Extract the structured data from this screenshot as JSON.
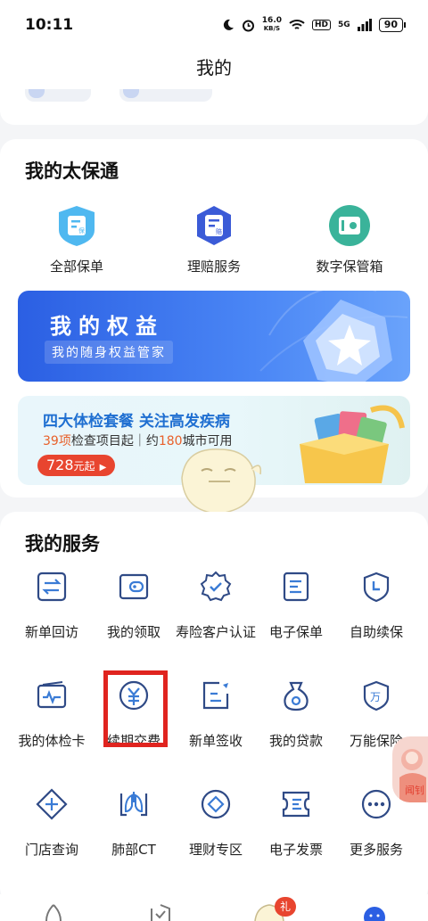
{
  "status_bar": {
    "time": "10:11",
    "net_speed_value": "16.0",
    "net_speed_unit": "KB/S",
    "hd": "HD",
    "network": "5G",
    "battery": "90"
  },
  "header": {
    "title": "我的"
  },
  "my_taibaotong": {
    "title": "我的太保通",
    "items": [
      {
        "label": "全部保单",
        "icon": "policy-shield-icon"
      },
      {
        "label": "理赔服务",
        "icon": "claim-service-icon"
      },
      {
        "label": "数字保管箱",
        "icon": "digital-safe-icon"
      }
    ]
  },
  "rights_banner": {
    "title": "我的权益",
    "subtitle": "我的随身权益管家"
  },
  "checkup_banner": {
    "title": "四大体检套餐  关注高发疾病",
    "sub_num1": "39项",
    "sub_text1": "检查项目起｜约",
    "sub_num2": "180",
    "sub_text2": "城市可用",
    "price": "728",
    "price_unit": "元起"
  },
  "my_services": {
    "title": "我的服务",
    "items": [
      {
        "label": "新单回访",
        "icon": "exchange-icon"
      },
      {
        "label": "我的领取",
        "icon": "wallet-icon"
      },
      {
        "label": "寿险客户认证",
        "icon": "verified-badge-icon"
      },
      {
        "label": "电子保单",
        "icon": "document-icon"
      },
      {
        "label": "自助续保",
        "icon": "shield-clock-icon"
      },
      {
        "label": "我的体检卡",
        "icon": "health-card-icon"
      },
      {
        "label": "续期交费",
        "icon": "yuan-payment-icon"
      },
      {
        "label": "新单签收",
        "icon": "sign-icon"
      },
      {
        "label": "我的贷款",
        "icon": "money-bag-icon"
      },
      {
        "label": "万能保险",
        "icon": "wan-shield-icon"
      },
      {
        "label": "门店查询",
        "icon": "store-location-icon"
      },
      {
        "label": "肺部CT",
        "icon": "lungs-icon"
      },
      {
        "label": "理财专区",
        "icon": "finance-diamond-icon"
      },
      {
        "label": "电子发票",
        "icon": "invoice-icon"
      },
      {
        "label": "更多服务",
        "icon": "more-dots-icon"
      }
    ]
  },
  "colors": {
    "accent_blue": "#2b5fe3",
    "icon_blue": "#2f4a86",
    "highlight_red": "#e0241f",
    "price_red": "#e8452f"
  },
  "float_badge": {
    "text": "闻钊"
  },
  "gift_badge": {
    "text": "礼"
  }
}
